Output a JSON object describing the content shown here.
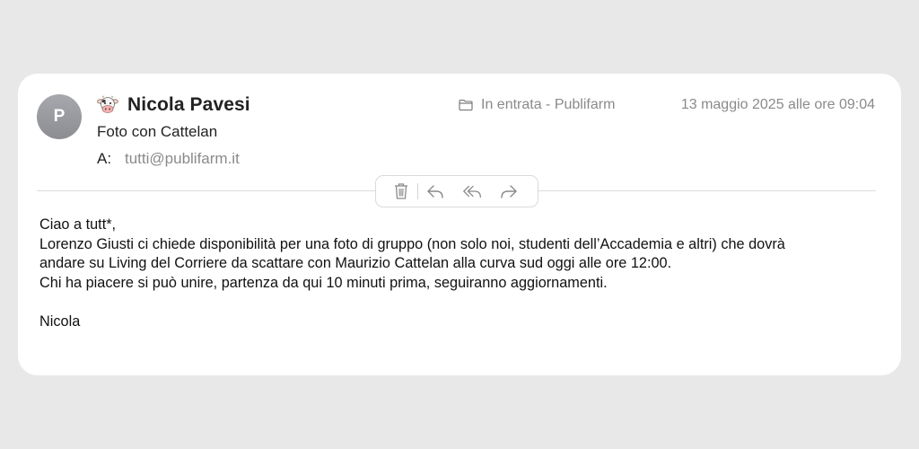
{
  "message": {
    "avatar_initial": "P",
    "sender_emoji": "cow-face-icon",
    "sender_name": "Nicola Pavesi",
    "subject": "Foto con Cattelan",
    "to_label": "A:",
    "to_address": "tutti@publifarm.it",
    "mailbox": "In entrata - Publifarm",
    "date": "13 maggio 2025 alle ore 09:04"
  },
  "toolbar": {
    "icons": [
      "trash-icon",
      "reply-icon",
      "reply-all-icon",
      "forward-icon"
    ]
  },
  "body": {
    "greeting": "Ciao a tutt*,",
    "line1": "Lorenzo Giusti ci chiede disponibilità per una foto di gruppo (non solo noi, studenti dell’Accademia e altri) che dovrà",
    "line2": "andare su Living del Corriere da scattare con Maurizio Cattelan alla curva sud oggi alle ore 12:00.",
    "line3": "Chi ha piacere si può unire, partenza da qui 10 minuti prima, seguiranno aggiornamenti.",
    "signature": "Nicola"
  },
  "colors": {
    "background": "#e8e8e8",
    "card": "#ffffff",
    "secondary_text": "#8a8a8a",
    "avatar": "#9a9ba0"
  }
}
